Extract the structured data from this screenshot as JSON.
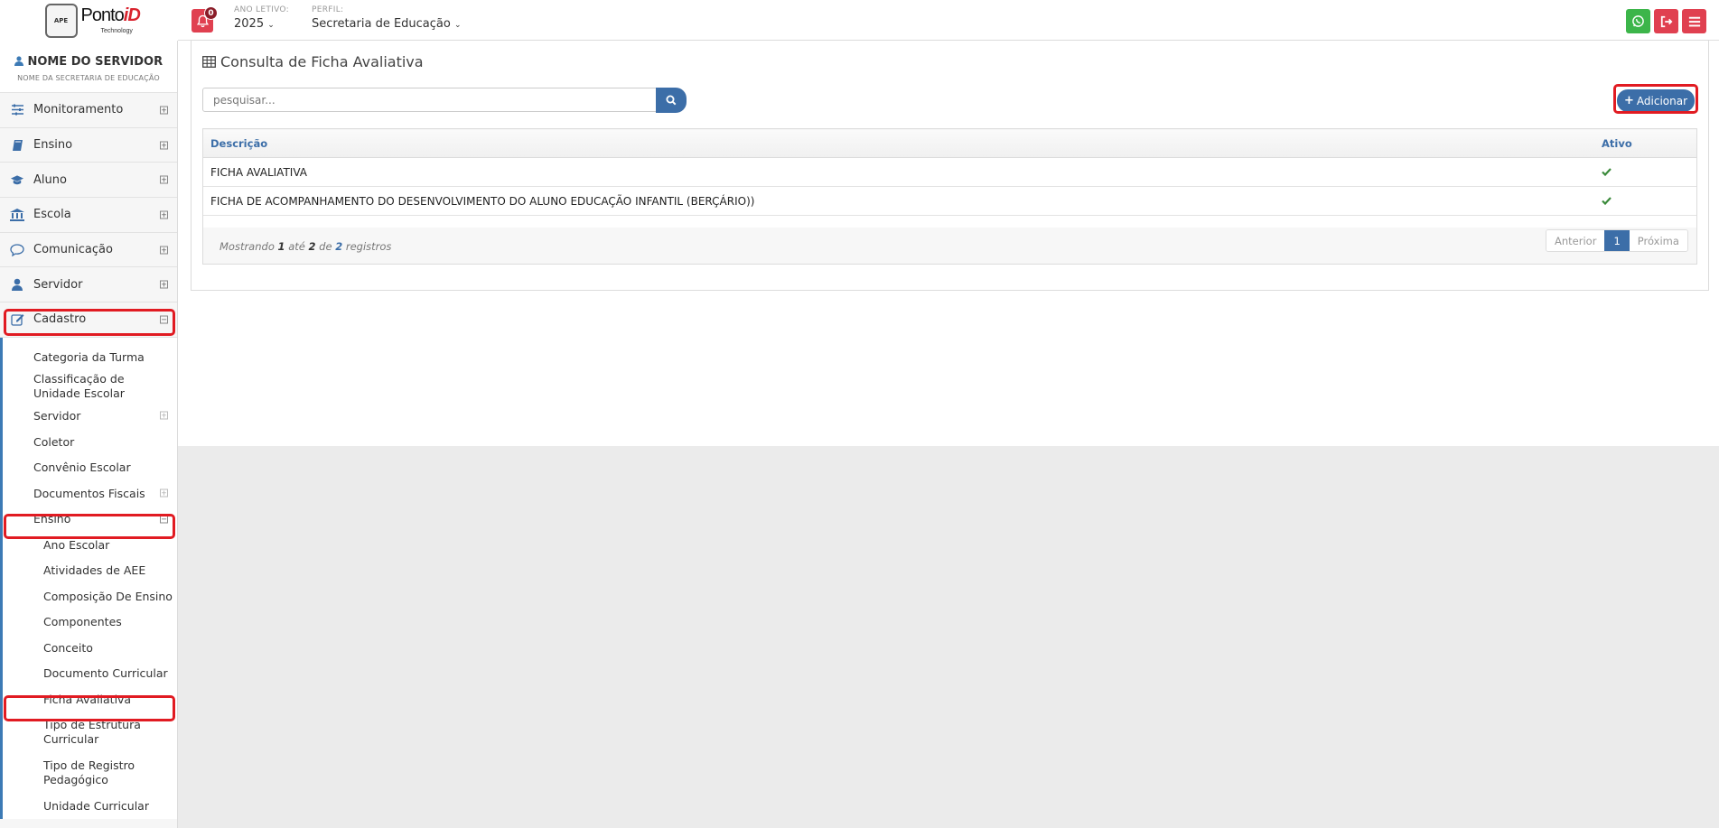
{
  "header": {
    "logo_badge": "APE",
    "logo_text_main": "Ponto",
    "logo_text_accent": "iD",
    "logo_sub": "Technology",
    "notification_count": "0",
    "ano_letivo_label": "ANO LETIVO:",
    "ano_letivo_value": "2025",
    "perfil_label": "PERFIL:",
    "perfil_value": "Secretaria de Educação",
    "colors": {
      "whatsapp": "#3cb54a",
      "logout": "#e04050",
      "menu": "#e04050"
    }
  },
  "sidebar": {
    "user_name": "NOME DO SERVIDOR",
    "user_sub": "NOME DA SECRETARIA DE EDUCAÇÃO",
    "items": [
      {
        "label": "Monitoramento",
        "icon": "sliders-icon"
      },
      {
        "label": "Ensino",
        "icon": "book-icon"
      },
      {
        "label": "Aluno",
        "icon": "graduation-cap-icon"
      },
      {
        "label": "Escola",
        "icon": "bank-icon"
      },
      {
        "label": "Comunicação",
        "icon": "comment-icon"
      },
      {
        "label": "Servidor",
        "icon": "user-icon"
      },
      {
        "label": "Cadastro",
        "icon": "edit-icon"
      }
    ],
    "cadastro_sub": [
      {
        "label": "Categoria da Turma"
      },
      {
        "label": "Classificação de Unidade Escolar"
      },
      {
        "label": "Servidor"
      },
      {
        "label": "Coletor"
      },
      {
        "label": "Convênio Escolar"
      },
      {
        "label": "Documentos Fiscais"
      },
      {
        "label": "Ensino"
      }
    ],
    "ensino_sub": [
      {
        "label": "Ano Escolar"
      },
      {
        "label": "Atividades de AEE"
      },
      {
        "label": "Composição De Ensino"
      },
      {
        "label": "Componentes"
      },
      {
        "label": "Conceito"
      },
      {
        "label": "Documento Curricular"
      },
      {
        "label": "Ficha Avaliativa"
      },
      {
        "label": "Tipo de Estrutura Curricular"
      },
      {
        "label": "Tipo de Registro Pedagógico"
      },
      {
        "label": "Unidade Curricular"
      }
    ]
  },
  "main": {
    "title": "Consulta de Ficha Avaliativa",
    "search_placeholder": "pesquisar...",
    "add_label": "Adicionar",
    "columns": {
      "descricao": "Descrição",
      "ativo": "Ativo"
    },
    "rows": [
      {
        "descricao": "FICHA AVALIATIVA",
        "ativo": true
      },
      {
        "descricao": "FICHA DE ACOMPANHAMENTO DO DESENVOLVIMENTO DO ALUNO EDUCAÇÃO INFANTIL (BERÇÁRIO))",
        "ativo": true
      }
    ],
    "footer": {
      "mostrando": "Mostrando",
      "from": "1",
      "ate": "até",
      "to": "2",
      "de": "de",
      "total": "2",
      "registros": "registros"
    },
    "pager": {
      "prev": "Anterior",
      "current": "1",
      "next": "Próxima"
    }
  }
}
